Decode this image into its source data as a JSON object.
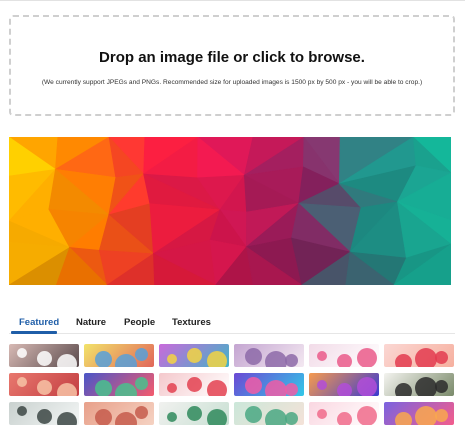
{
  "upload": {
    "title": "Drop an image file or click to browse.",
    "note": "(We currently support JPEGs and PNGs. Recommended size for uploaded images is 1500 px by 500 px - you will be able to crop.)"
  },
  "tabs": [
    {
      "label": "Featured",
      "active": true
    },
    {
      "label": "Nature",
      "active": false
    },
    {
      "label": "People",
      "active": false
    },
    {
      "label": "Textures",
      "active": false
    }
  ],
  "colors": {
    "accent": "#1f5ea8",
    "dropzone_border": "#cfcfcf",
    "banner_gradient": [
      "#f7c800",
      "#ff7a00",
      "#ee1d3d",
      "#d1154f",
      "#8a1f5e",
      "#1e8a82",
      "#13b094"
    ]
  },
  "thumbnails": [
    {
      "name": "thumb-winter-lake",
      "colors": [
        "#d7b9b4",
        "#ffffff",
        "#5a4a4c"
      ]
    },
    {
      "name": "thumb-colorful-people",
      "colors": [
        "#f2e36a",
        "#57a0d9",
        "#e1665a"
      ]
    },
    {
      "name": "thumb-purple-shapes",
      "colors": [
        "#c96adb",
        "#f3d343",
        "#42b3c7"
      ]
    },
    {
      "name": "thumb-violet-objects",
      "colors": [
        "#c4a5d1",
        "#8d6aa8",
        "#f3e8f1"
      ]
    },
    {
      "name": "thumb-pink-toys",
      "colors": [
        "#f2dbe8",
        "#ea5a8a",
        "#ffffff"
      ]
    },
    {
      "name": "thumb-red-flowers",
      "colors": [
        "#fbd7d3",
        "#e33b4f",
        "#f6b09f"
      ]
    },
    {
      "name": "thumb-coral-scene",
      "colors": [
        "#e8786e",
        "#f7c3a6",
        "#c33e42"
      ]
    },
    {
      "name": "thumb-rainbow-waves",
      "colors": [
        "#4a56c8",
        "#49c18d",
        "#f45b6d"
      ]
    },
    {
      "name": "thumb-pink-gadgets",
      "colors": [
        "#f4c8cc",
        "#e34150",
        "#ffffff"
      ]
    },
    {
      "name": "thumb-neon-city",
      "colors": [
        "#6b48d4",
        "#f05ca6",
        "#33c8e8"
      ]
    },
    {
      "name": "thumb-orange-shapes",
      "colors": [
        "#f69a4e",
        "#b14ed8",
        "#3a3ad0"
      ]
    },
    {
      "name": "thumb-dark-tree",
      "colors": [
        "#f3f3ef",
        "#2b2b2b",
        "#7a8a6a"
      ]
    },
    {
      "name": "thumb-grey-branches",
      "colors": [
        "#c9d1cf",
        "#3c4644",
        "#f3f6f5"
      ]
    },
    {
      "name": "thumb-desert-dunes",
      "colors": [
        "#e8a08a",
        "#c55c4c",
        "#f5d2c2"
      ]
    },
    {
      "name": "thumb-green-sculpture",
      "colors": [
        "#f1f1ef",
        "#2f8a5c",
        "#c8e0d3"
      ]
    },
    {
      "name": "thumb-mint-objects",
      "colors": [
        "#cbe7d9",
        "#4aa883",
        "#f4e2d8"
      ]
    },
    {
      "name": "thumb-pink-spheres",
      "colors": [
        "#fad7e1",
        "#f06b8b",
        "#ffffff"
      ]
    },
    {
      "name": "thumb-rainbow-orbs",
      "colors": [
        "#7a63e0",
        "#f9a84e",
        "#f35d8c"
      ]
    }
  ]
}
